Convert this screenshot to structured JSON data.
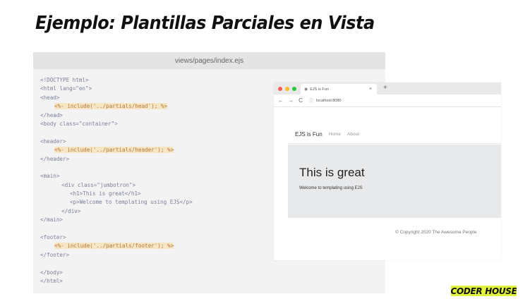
{
  "slide": {
    "title": "Ejemplo: Plantillas Parciales en Vista",
    "logo_text": "CODER HOUSE"
  },
  "code_panel": {
    "filename": "views/pages/index.ejs",
    "lines": [
      {
        "text": "<!DOCTYPE html>",
        "indent": 0,
        "highlight": false
      },
      {
        "text": "<html lang=\"en\">",
        "indent": 0,
        "highlight": false
      },
      {
        "text": "<head>",
        "indent": 0,
        "highlight": false
      },
      {
        "text": "<%- include('../partials/head'); %>",
        "indent": 1,
        "highlight": true
      },
      {
        "text": "</head>",
        "indent": 0,
        "highlight": false
      },
      {
        "text": "<body class=\"container\">",
        "indent": 0,
        "highlight": false
      },
      {
        "text": "",
        "indent": 0,
        "highlight": false
      },
      {
        "text": "<header>",
        "indent": 0,
        "highlight": false
      },
      {
        "text": "<%- include('../partials/header'); %>",
        "indent": 1,
        "highlight": true
      },
      {
        "text": "</header>",
        "indent": 0,
        "highlight": false
      },
      {
        "text": "",
        "indent": 0,
        "highlight": false
      },
      {
        "text": "<main>",
        "indent": 0,
        "highlight": false
      },
      {
        "text": "<div class=\"jumbotron\">",
        "indent": 2,
        "highlight": false
      },
      {
        "text": "<h1>This is great</h1>",
        "indent": 3,
        "highlight": false
      },
      {
        "text": "<p>Welcome to templating using EJS</p>",
        "indent": 3,
        "highlight": false
      },
      {
        "text": "</div>",
        "indent": 2,
        "highlight": false
      },
      {
        "text": "</main>",
        "indent": 0,
        "highlight": false
      },
      {
        "text": "",
        "indent": 0,
        "highlight": false
      },
      {
        "text": "<footer>",
        "indent": 0,
        "highlight": false
      },
      {
        "text": "<%- include('../partials/footer'); %>",
        "indent": 1,
        "highlight": true
      },
      {
        "text": "</footer>",
        "indent": 0,
        "highlight": false
      },
      {
        "text": "",
        "indent": 0,
        "highlight": false
      },
      {
        "text": "</body>",
        "indent": 0,
        "highlight": false
      },
      {
        "text": "</html>",
        "indent": 0,
        "highlight": false
      }
    ]
  },
  "browser": {
    "traffic_light_colors": [
      "#ff5f57",
      "#febc2e",
      "#28c840"
    ],
    "tab_title": "EJS is Fun",
    "tab_close": "×",
    "new_tab": "+",
    "back": "←",
    "forward": "→",
    "reload": "C",
    "address": "localhost:8080",
    "site": {
      "brand": "EJS is Fun",
      "nav_links": [
        "Home",
        "About"
      ],
      "heading": "This is great",
      "paragraph": "Welcome to templating using EJS",
      "footer": "© Copyright 2020 The Awesome People"
    }
  }
}
